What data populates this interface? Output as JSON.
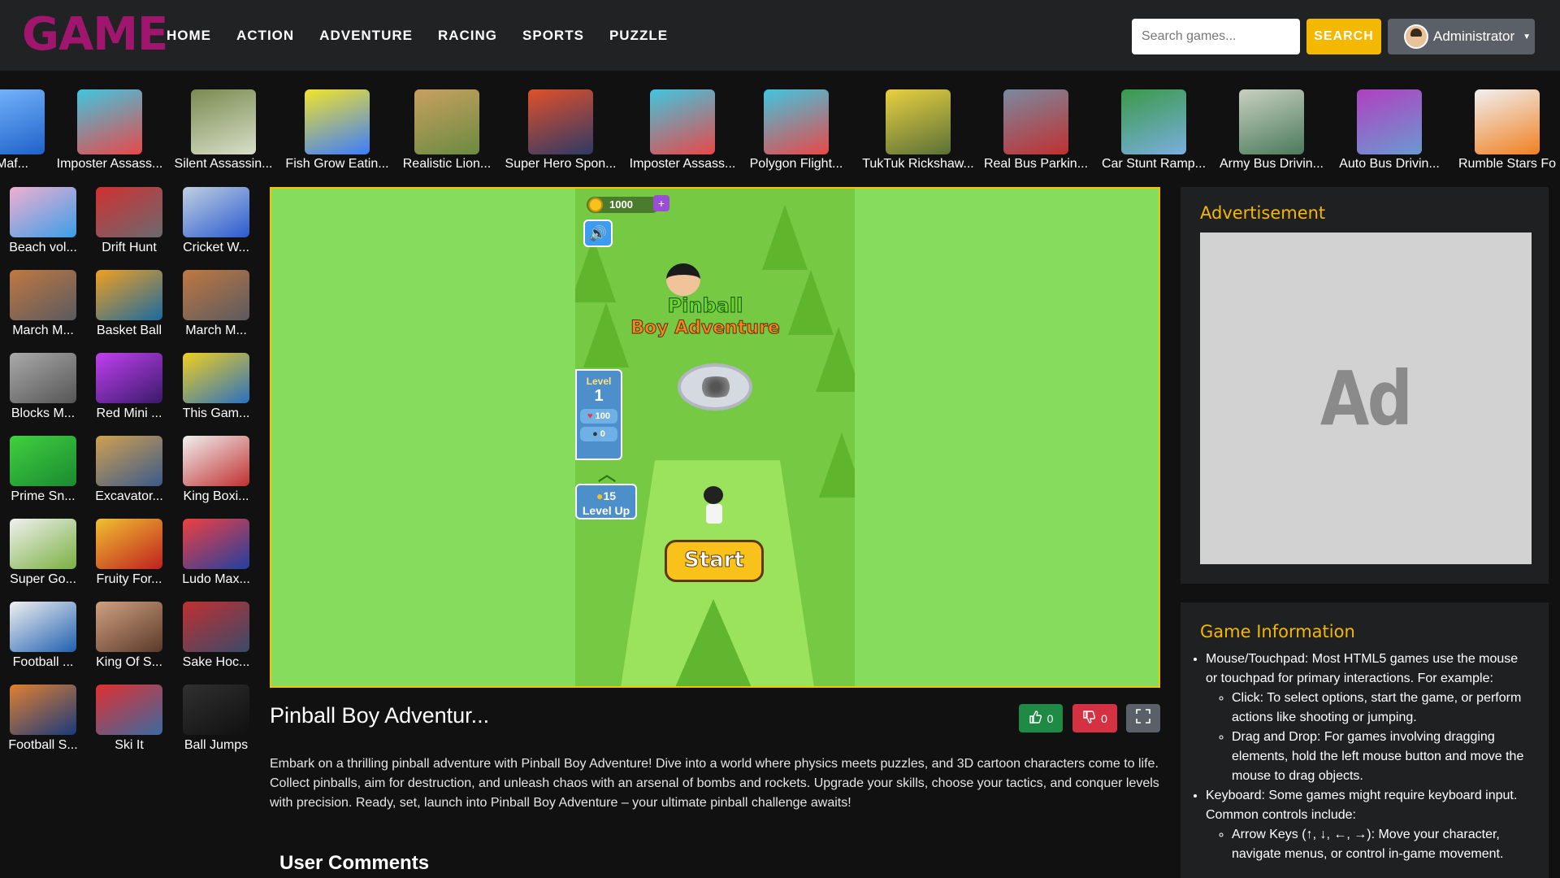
{
  "logo": "GAME",
  "nav": [
    "HOME",
    "ACTION",
    "ADVENTURE",
    "RACING",
    "SPORTS",
    "PUZZLE"
  ],
  "search": {
    "placeholder": "Search games...",
    "button": "SEARCH"
  },
  "user": {
    "name": "Administrator"
  },
  "top_games": [
    "Maf...",
    "Imposter Assass...",
    "Silent Assassin...",
    "Fish Grow Eatin...",
    "Realistic Lion...",
    "Super Hero Spon...",
    "Imposter Assass...",
    "Polygon Flight...",
    "TukTuk Rickshaw...",
    "Real Bus Parkin...",
    "Car Stunt Ramp...",
    "Army Bus Drivin...",
    "Auto Bus Drivin...",
    "Rumble Stars Fo"
  ],
  "side_games": [
    [
      "Beach vol...",
      "Drift Hunt",
      "Cricket W..."
    ],
    [
      "March M...",
      "Basket Ball",
      "March M..."
    ],
    [
      "Blocks M...",
      "Red Mini ...",
      "This Gam..."
    ],
    [
      "Prime Sn...",
      "Excavator...",
      "King Boxi..."
    ],
    [
      "Super Go...",
      "Fruity For...",
      "Ludo Max..."
    ],
    [
      "Football ...",
      "King Of S...",
      "Sake Hoc..."
    ],
    [
      "Football S...",
      "Ski It",
      "Ball Jumps"
    ]
  ],
  "game_canvas": {
    "coins": "1000",
    "title_line1": "Pinball",
    "title_line2": "Boy Adventure",
    "level_label": "Level",
    "level_num": "1",
    "health": "100",
    "bombs": "0",
    "levelup_cost": "15",
    "levelup_label": "Level Up",
    "start_label": "Start"
  },
  "game": {
    "title": "Pinball Boy Adventur...",
    "likes": "0",
    "dislikes": "0",
    "description": "Embark on a thrilling pinball adventure with Pinball Boy Adventure! Dive into a world where physics meets puzzles, and 3D cartoon characters come to life. Collect pinballs, aim for destruction, and unleash chaos with an arsenal of bombs and rockets. Upgrade your skills, choose your tactics, and conquer levels with precision. Ready, set, launch into Pinball Boy Adventure – your ultimate pinball challenge awaits!"
  },
  "comments_title": "User Comments",
  "ad": {
    "title": "Advertisement",
    "text": "Ad"
  },
  "info": {
    "title": "Game Information",
    "mouse": "Mouse/Touchpad: Most HTML5 games use the mouse or touchpad for primary interactions. For example:",
    "click": "Click: To select options, start the game, or perform actions like shooting or jumping.",
    "drag": "Drag and Drop: For games involving dragging elements, hold the left mouse button and move the mouse to drag objects.",
    "keyboard": "Keyboard: Some games might require keyboard input. Common controls include:",
    "arrows": "Arrow Keys (↑, ↓, ←, →): Move your character, navigate menus, or control in-game movement."
  },
  "colors": {
    "brand": "#a0166e",
    "accent": "#f5b800",
    "like": "#1e8a43",
    "dislike": "#d43242",
    "game_bg": "#86dc5c"
  }
}
